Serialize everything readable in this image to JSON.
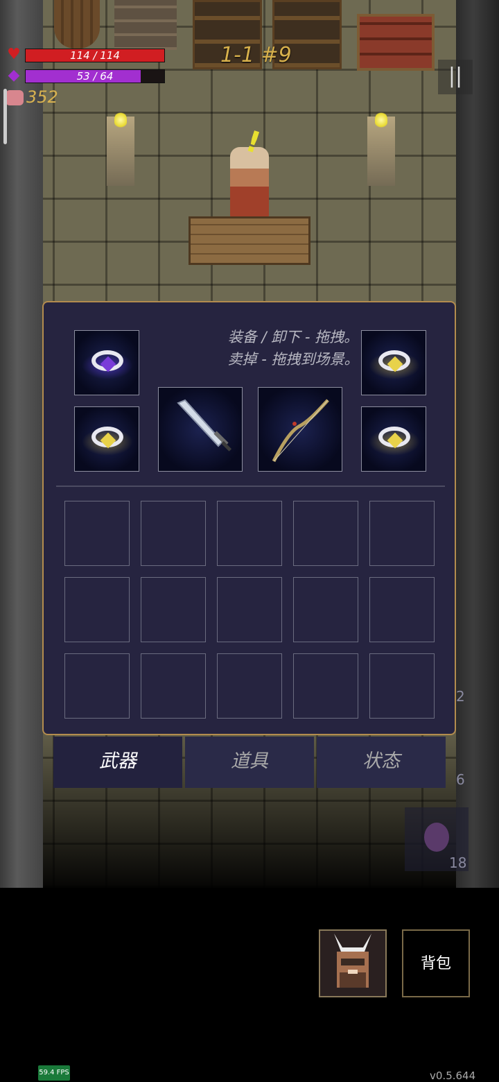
{
  "hud": {
    "hp_text": "114 / 114",
    "hp_fraction": 1.0,
    "hp_color": "#d11e22",
    "mp_text": "53 / 64",
    "mp_fraction": 0.828,
    "mp_color": "#a22fd0",
    "gold": "352",
    "level": "1-1 #9",
    "pause_icon": "pause-icon"
  },
  "inventory": {
    "hint_line1": "装备 / 卸下 - 拖拽。",
    "hint_line2": "卖掉 - 拖拽到场景。",
    "equipped": [
      {
        "name": "ring-purple-swirl",
        "gem_color": "#7a3cd8"
      },
      {
        "name": "ring-yellow-cross",
        "gem_color": "#e8d24a"
      },
      {
        "name": "ring-yellow-shell",
        "gem_color": "#e8d24a"
      },
      {
        "name": "sword",
        "icon": "sword-icon"
      },
      {
        "name": "bow",
        "icon": "bow-icon"
      },
      {
        "name": "ring-yellow-cross",
        "gem_color": "#e8d24a"
      }
    ],
    "grid_rows": 3,
    "grid_cols": 5
  },
  "tabs": [
    {
      "label": "武器",
      "active": true
    },
    {
      "label": "道具",
      "active": false
    },
    {
      "label": "状态",
      "active": false
    }
  ],
  "side_counts": {
    "a": "2",
    "b": "6",
    "potion": "18"
  },
  "bottom": {
    "bag_label": "背包",
    "fps": "59.4 FPS",
    "version": "v0.5.644"
  }
}
